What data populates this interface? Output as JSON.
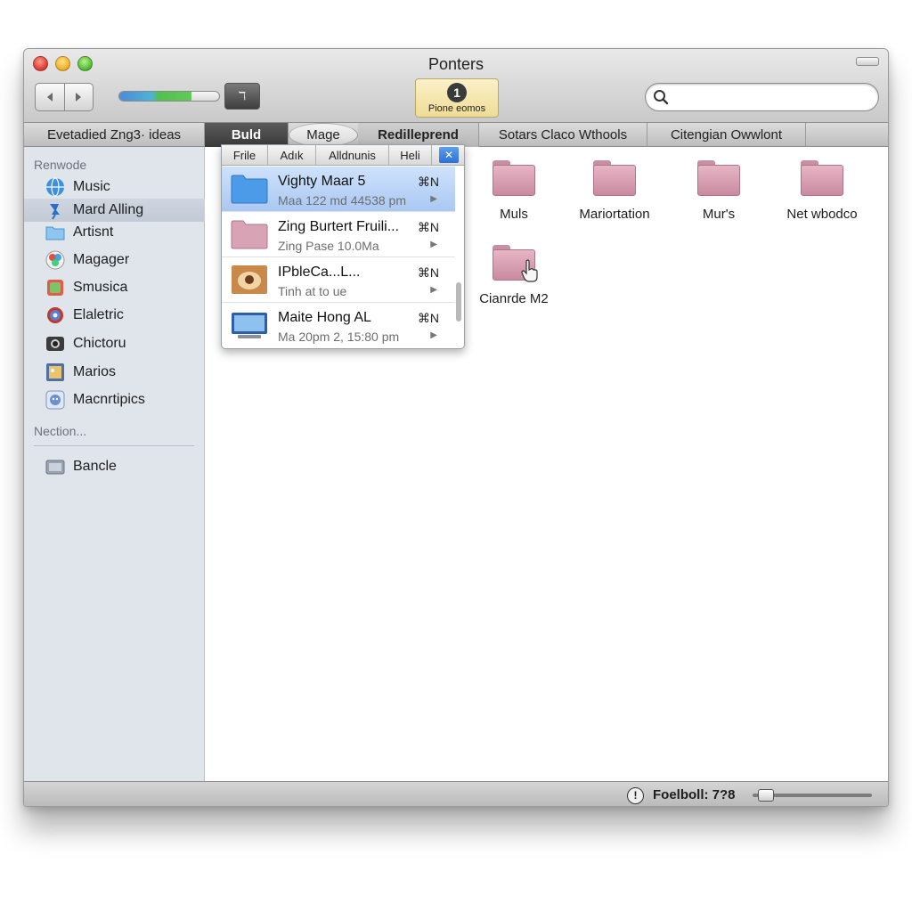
{
  "window": {
    "title": "Ponters"
  },
  "toolbar": {
    "back_icon": "back-arrow-icon",
    "forward_icon": "forward-arrow-icon",
    "progress_value": 0.72,
    "action_glyph": "ℸ",
    "info": {
      "number": "1",
      "label": "Pione eomos"
    },
    "search": {
      "value": "",
      "placeholder": ""
    }
  },
  "tabs": [
    {
      "label": "Evetadied Zng3· ideas"
    },
    {
      "label": "Buld"
    },
    {
      "label": "Mage"
    },
    {
      "label": "Redilleprend"
    },
    {
      "label": "Sotars Claco Wthools"
    },
    {
      "label": "Citengian Owwlont"
    }
  ],
  "sidebar": {
    "section1": "Renwode",
    "items": [
      {
        "label": "Music",
        "icon": "globe-icon"
      },
      {
        "label": "Mard Alling",
        "icon": "pin-icon"
      },
      {
        "label": "Artisnt",
        "icon": "folder-icon"
      },
      {
        "label": "Magager",
        "icon": "photos-icon"
      },
      {
        "label": "Smusica",
        "icon": "app-icon"
      },
      {
        "label": "Elaletric",
        "icon": "gear-icon"
      },
      {
        "label": "Chictoru",
        "icon": "camera-icon"
      },
      {
        "label": "Marios",
        "icon": "picture-icon"
      },
      {
        "label": "Macnrtipics",
        "icon": "finder-icon"
      }
    ],
    "section2": "Nection...",
    "items2": [
      {
        "label": "Bancle",
        "icon": "drive-icon"
      }
    ]
  },
  "menu": {
    "tabs": [
      {
        "label": "Frile"
      },
      {
        "label": "Adık"
      },
      {
        "label": "Alldnunis"
      },
      {
        "label": "Heli"
      }
    ],
    "close_glyph": "✕",
    "rows": [
      {
        "title": "Vighty Maar 5",
        "subtitle": "Maa 122 md 44538 pm",
        "shortcut": "⌘N",
        "arrow": "▶"
      },
      {
        "title": "Zing Burtert Fruili...",
        "subtitle": "Zing Pase 10.0Ma",
        "shortcut": "⌘N",
        "arrow": "▶"
      },
      {
        "title": "IPbleCa...L...",
        "subtitle": "Tinh at to ue",
        "shortcut": "⌘N",
        "arrow": "▶"
      },
      {
        "title": "Maite Hong AL",
        "subtitle": "Ma 20pm 2, 15:80 pm",
        "shortcut": "⌘N",
        "arrow": "▶"
      }
    ]
  },
  "content": {
    "folders": [
      {
        "label": "Muls"
      },
      {
        "label": "Mariortation"
      },
      {
        "label": "Mur's"
      },
      {
        "label": "Net wbodco"
      },
      {
        "label": "Cianrde M2"
      }
    ]
  },
  "statusbar": {
    "icon_glyph": "!",
    "text": "Foelboll: 7?8",
    "slider_value": 0.05
  },
  "colors": {
    "folder": "#d8a3b5",
    "selection": "#a9c8f3",
    "sidebar": "#e0e5ec"
  }
}
